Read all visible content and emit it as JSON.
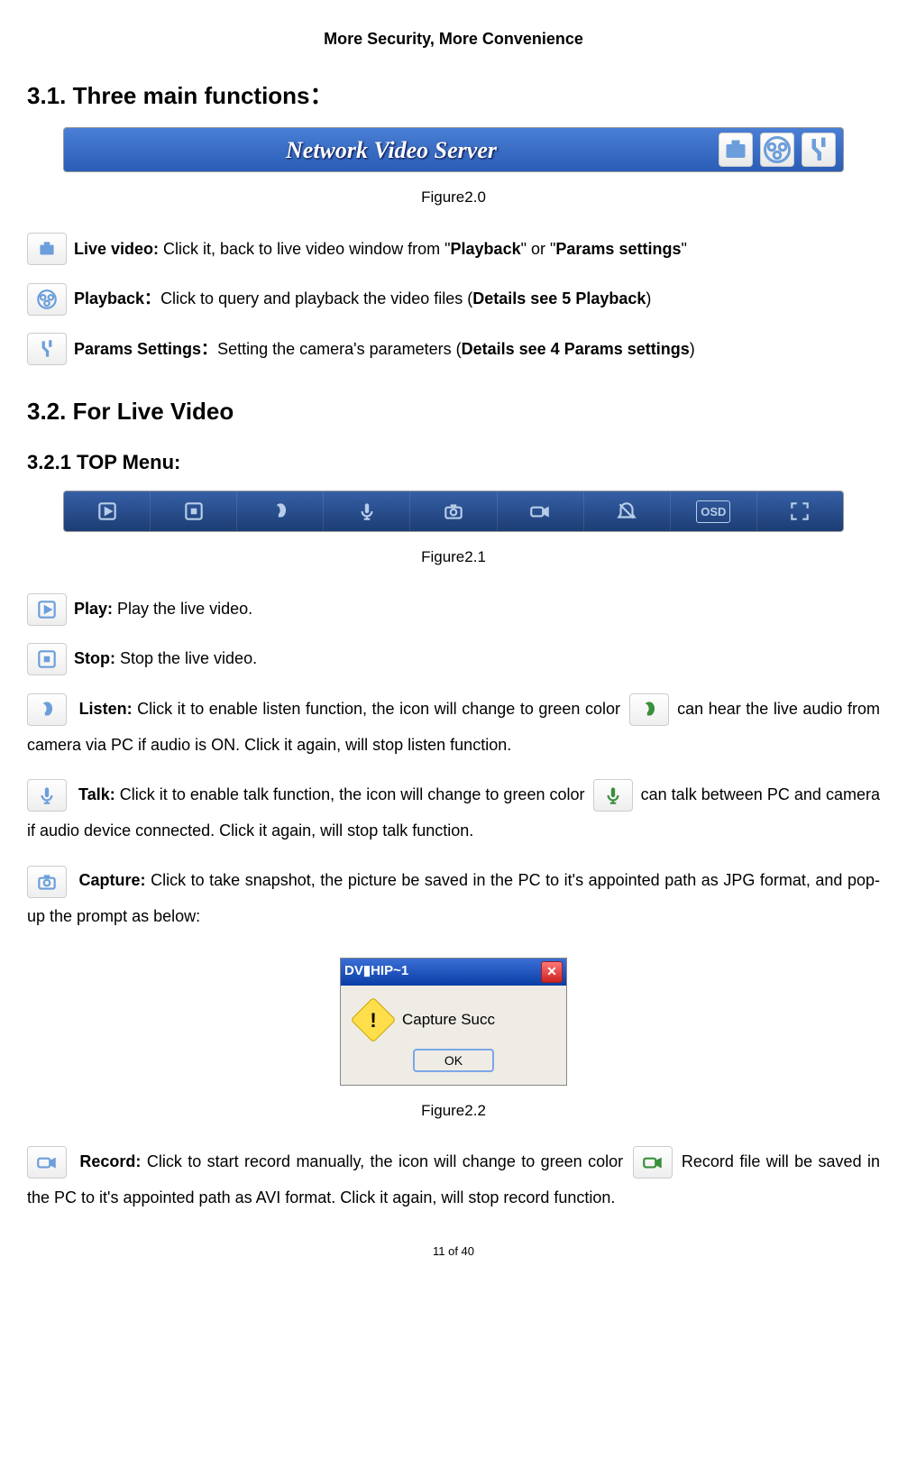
{
  "header": "More Security, More Convenience",
  "section31": {
    "title": "3.1. Three main functions：",
    "banner_title": "Network Video Server",
    "caption": "Figure2.0",
    "live_video_label": "Live video:",
    "live_video_pre": " Click it, back to live video window from \"",
    "live_video_b1": "Playback",
    "live_video_mid": "\" or \"",
    "live_video_b2": "Params settings",
    "live_video_post": "\"",
    "playback_label": "Playback：",
    "playback_pre": "Click to query and playback the video files (",
    "playback_b": "Details see 5 Playback",
    "playback_post": ")",
    "params_label": "Params Settings：",
    "params_pre": "Setting the camera's parameters (",
    "params_b": "Details see 4 Params settings",
    "params_post": ")"
  },
  "section32": {
    "title": "3.2. For Live Video",
    "sub_title": "3.2.1 TOP Menu:",
    "caption": "Figure2.1",
    "play_label": "Play:",
    "play_text": " Play the live video.",
    "stop_label": "Stop:",
    "stop_text": " Stop the live video.",
    "listen_label": "Listen:",
    "listen_pre": " Click it to enable listen function, the icon will change to green color",
    "listen_post": " can hear the live audio from camera via PC if audio is ON. Click it again, will stop listen function.",
    "talk_label": "Talk:",
    "talk_pre": " Click it to enable talk function, the icon will change to green color",
    "talk_post": " can talk between PC and camera if audio device connected. Click it again, will stop talk function.",
    "capture_label": "Capture:",
    "capture_text": " Click to take snapshot, the picture be saved in the PC to it's appointed path as JPG format, and pop-up the prompt as below:",
    "dialog_title": "DV▮HIP~1",
    "dialog_msg": "Capture Succ",
    "dialog_ok": "OK",
    "caption2": "Figure2.2",
    "record_label": "Record:",
    "record_pre": " Click to start record manually, the icon will change to green color",
    "record_post": " Record file will be saved in the PC to it's appointed path as AVI format. Click it again, will stop record function."
  },
  "footer": "11 of 40"
}
